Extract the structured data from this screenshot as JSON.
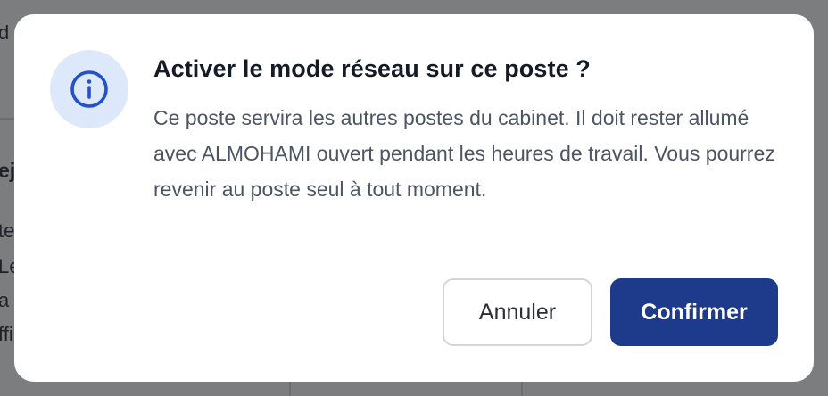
{
  "background": {
    "fragments": [
      "d",
      "ej",
      "te",
      "Le",
      "a p",
      "ffi"
    ]
  },
  "dialog": {
    "icon": "info-icon",
    "title": "Activer le mode réseau sur ce poste ?",
    "body": "Ce poste servira les autres postes du cabinet. Il doit rester allumé avec ALMOHAMI ouvert pendant les heures de travail. Vous pourrez revenir au poste seul à tout moment.",
    "cancel_label": "Annuler",
    "confirm_label": "Confirmer"
  },
  "colors": {
    "overlay": "#7c7d7f",
    "icon_bg": "#dde9fb",
    "icon_stroke": "#2251c9",
    "confirm_bg": "#1e3a8a"
  }
}
